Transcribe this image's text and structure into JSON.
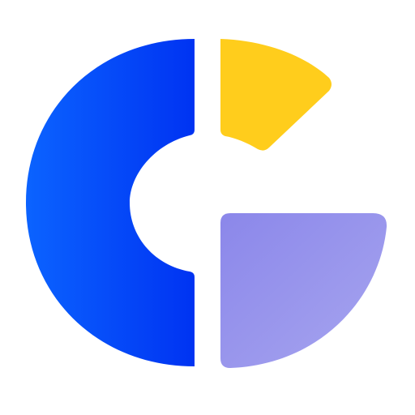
{
  "logo": {
    "shape": "stylized-letter-G",
    "colors": {
      "background": "#ffffff",
      "blue_left": "#0B63FF",
      "blue_right": "#0033F2",
      "yellow": "#FFCD1C",
      "purple_light": "#A7A5EF",
      "purple_dark": "#8B87EA"
    }
  }
}
